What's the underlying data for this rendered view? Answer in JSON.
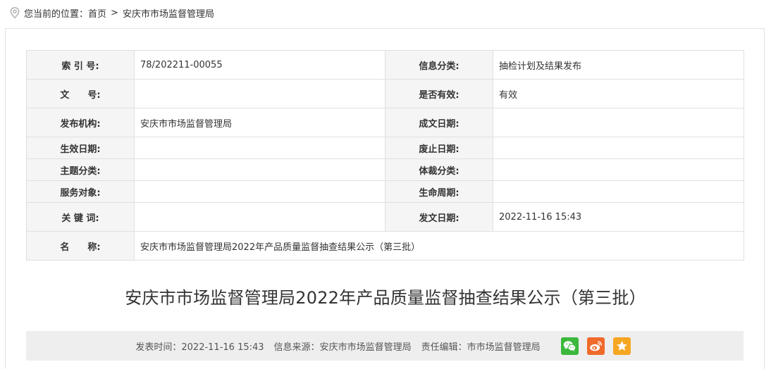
{
  "breadcrumb": {
    "prefix": "您当前的位置：",
    "home": "首页",
    "separator": ">",
    "current": "安庆市市场监督管理局"
  },
  "meta_table": {
    "rows": [
      {
        "l1": "索 引 号:",
        "v1": "78/202211-00055",
        "l2": "信息分类:",
        "v2": "抽检计划及结果发布"
      },
      {
        "l1": "文　　号:",
        "v1": "",
        "l2": "是否有效:",
        "v2": "有效"
      },
      {
        "l1": "发布机构:",
        "v1": "安庆市市场监督管理局",
        "l2": "成文日期:",
        "v2": ""
      },
      {
        "l1": "生效日期:",
        "v1": "",
        "l2": "废止日期:",
        "v2": ""
      },
      {
        "l1": "主题分类:",
        "v1": "",
        "l2": "体裁分类:",
        "v2": ""
      },
      {
        "l1": "服务对象:",
        "v1": "",
        "l2": "生命周期:",
        "v2": ""
      },
      {
        "l1": "关 键 词:",
        "v1": "",
        "l2": "发文日期:",
        "v2": "2022-11-16 15:43"
      }
    ],
    "name_label": "名　　称:",
    "name_value": "安庆市市场监督管理局2022年产品质量监督抽查结果公示（第三批）"
  },
  "document": {
    "title": "安庆市市场监督管理局2022年产品质量监督抽查结果公示（第三批）"
  },
  "infobar": {
    "publish_time_label": "发表时间：",
    "publish_time": "2022-11-16 15:43",
    "source_label": "信息来源：",
    "source": "安庆市市场监督管理局",
    "editor_label": "责任编辑：",
    "editor": "市市场监督管理局"
  },
  "colors": {
    "wechat": "#3bb83b",
    "weibo": "#f06a2b",
    "favorite": "#f5a623",
    "label_bg": "#f5f5f5",
    "infobar_bg": "#eeeeee"
  },
  "icons": [
    "location-pin-icon",
    "wechat-icon",
    "weibo-icon",
    "star-icon"
  ]
}
